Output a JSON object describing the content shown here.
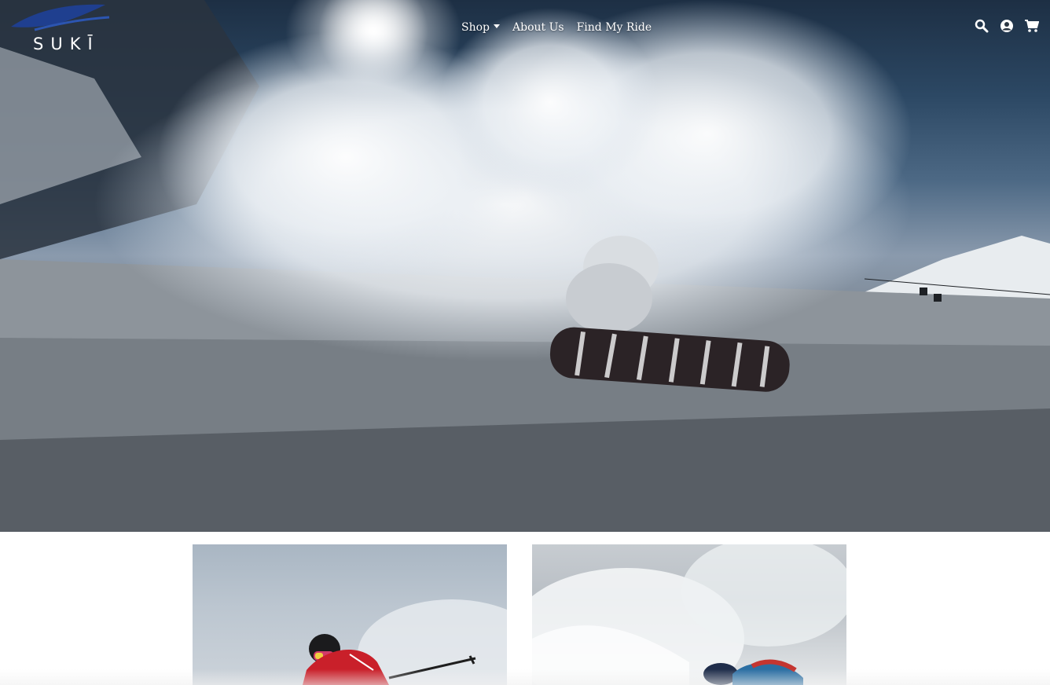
{
  "brand": {
    "name": "SUKĪ"
  },
  "nav": {
    "items": [
      {
        "label": "Shop",
        "dropdown": true
      },
      {
        "label": "About Us",
        "dropdown": false
      },
      {
        "label": "Find My Ride",
        "dropdown": false
      }
    ],
    "icons": [
      "search-icon",
      "account-icon",
      "cart-icon"
    ]
  },
  "hero": {
    "image": "snowboarder-powder-spray"
  },
  "cards": [
    {
      "image": "skier-red-jacket-poles"
    },
    {
      "image": "skier-powder-spray"
    }
  ],
  "colors": {
    "nav_text": "#ffffff",
    "logo_swoosh": "#1f3f8f",
    "page_bg": "#ffffff"
  }
}
